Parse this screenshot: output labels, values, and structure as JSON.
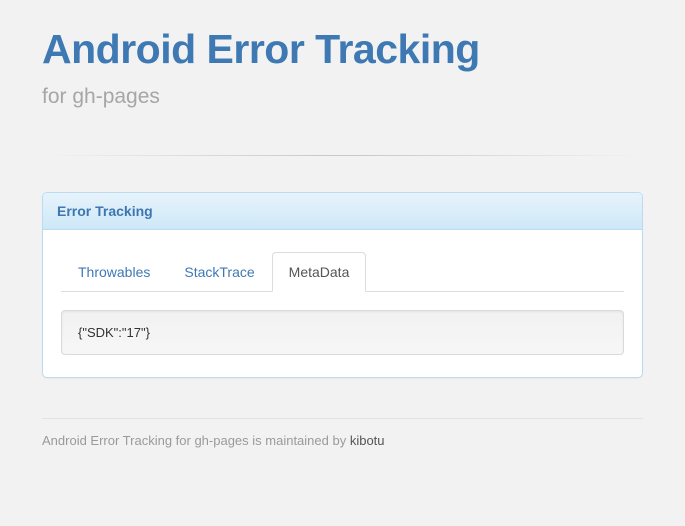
{
  "header": {
    "title": "Android Error Tracking",
    "subtitle": "for gh-pages"
  },
  "panel": {
    "heading": "Error Tracking",
    "tabs": [
      {
        "label": "Throwables",
        "active": false
      },
      {
        "label": "StackTrace",
        "active": false
      },
      {
        "label": "MetaData",
        "active": true
      }
    ],
    "metadata_content": "{\"SDK\":\"17\"}"
  },
  "footer": {
    "text_prefix": "Android Error Tracking for gh-pages is maintained by ",
    "maintainer": "kibotu"
  }
}
